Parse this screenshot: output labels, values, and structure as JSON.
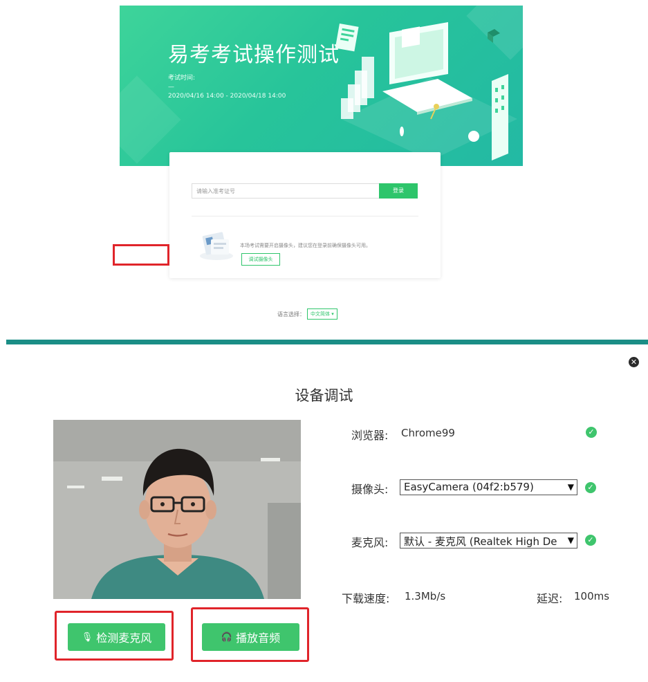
{
  "top_screenshot": {
    "title": "易考考试操作测试",
    "exam_time_label": "考试时间:",
    "exam_time_dash": "—",
    "exam_time_range": "2020/04/16 14:00 - 2020/04/18 14:00",
    "exam_id_placeholder": "请输入准考证号",
    "login_button": "登录",
    "camera_note": "本场考试需要开启摄像头，建议您在登录前确保摄像头可用。",
    "test_camera_button": "调试摄像头",
    "language_label": "语言选择：",
    "language_value": "中文简体",
    "language_chevron": "▾"
  },
  "dialog": {
    "close_glyph": "✕",
    "title": "设备调试",
    "browser": {
      "label": "浏览器:",
      "value": "Chrome99"
    },
    "camera": {
      "label": "摄像头:",
      "value": "EasyCamera (04f2:b579)"
    },
    "microphone": {
      "label": "麦克风:",
      "value": "默认 - 麦克风 (Realtek High De"
    },
    "download_speed": {
      "label": "下载速度:",
      "value": "1.3Mb/s"
    },
    "latency": {
      "label": "延迟:",
      "value": "100ms"
    },
    "check_glyph": "✓",
    "select_arrow": "▼",
    "mic_test_button": "检测麦克风",
    "play_audio_button": "播放音频",
    "mic_icon": "🎙",
    "headphone_icon": "🎧"
  },
  "colors": {
    "green": "#3fc56d",
    "teal": "#1b8e86",
    "red": "#e0242a",
    "hero": "#27c49a"
  },
  "icons": [
    "close-icon",
    "check-icon",
    "microphone-icon",
    "headphones-icon",
    "chevron-down-icon"
  ]
}
